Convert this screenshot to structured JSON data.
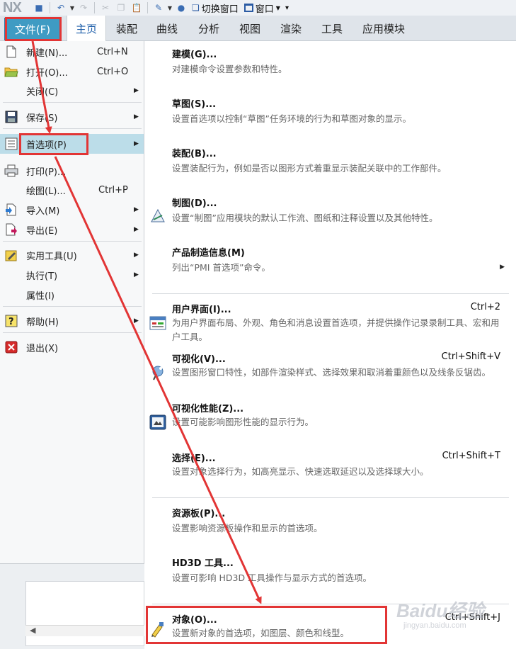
{
  "app": {
    "logo": "NX"
  },
  "quick_toolbar": {
    "switch_window_label": "切换窗口",
    "window_label": "窗口"
  },
  "ribbon": {
    "tabs": [
      {
        "label": "文件(F)"
      },
      {
        "label": "主页"
      },
      {
        "label": "装配"
      },
      {
        "label": "曲线"
      },
      {
        "label": "分析"
      },
      {
        "label": "视图"
      },
      {
        "label": "渲染"
      },
      {
        "label": "工具"
      },
      {
        "label": "应用模块"
      }
    ],
    "active_tab": "主页"
  },
  "file_menu": {
    "items": [
      {
        "label": "新建(N)...",
        "shortcut": "Ctrl+N",
        "icon": "new-file-icon"
      },
      {
        "label": "打开(O)...",
        "shortcut": "Ctrl+O",
        "icon": "open-folder-icon"
      },
      {
        "label": "关闭(C)",
        "shortcut": "",
        "icon": ""
      },
      {
        "label": "保存(S)",
        "shortcut": "",
        "icon": "save-icon"
      },
      {
        "label": "首选项(P)",
        "shortcut": "",
        "icon": "preferences-icon"
      },
      {
        "label": "打印(P)...",
        "shortcut": "",
        "icon": "printer-icon"
      },
      {
        "label": "绘图(L)...",
        "shortcut": "Ctrl+P",
        "icon": ""
      },
      {
        "label": "导入(M)",
        "shortcut": "",
        "icon": "import-icon"
      },
      {
        "label": "导出(E)",
        "shortcut": "",
        "icon": "export-icon"
      },
      {
        "label": "实用工具(U)",
        "shortcut": "",
        "icon": "utilities-icon"
      },
      {
        "label": "执行(T)",
        "shortcut": "",
        "icon": ""
      },
      {
        "label": "属性(I)",
        "shortcut": "",
        "icon": ""
      },
      {
        "label": "帮助(H)",
        "shortcut": "",
        "icon": "help-icon"
      },
      {
        "label": "退出(X)",
        "shortcut": "",
        "icon": "exit-icon"
      }
    ],
    "selected": "首选项(P)"
  },
  "preferences_panel": {
    "items": [
      {
        "title": "建模(G)...",
        "desc": "对建模命令设置参数和特性。",
        "shortcut": ""
      },
      {
        "title": "草图(S)...",
        "desc": "设置首选项以控制“草图”任务环境的行为和草图对象的显示。",
        "shortcut": ""
      },
      {
        "title": "装配(B)...",
        "desc": "设置装配行为，例如是否以图形方式着重显示装配关联中的工作部件。",
        "shortcut": ""
      },
      {
        "title": "制图(D)...",
        "desc": "设置“制图”应用模块的默认工作流、图纸和注释设置以及其他特性。",
        "shortcut": ""
      },
      {
        "title": "产品制造信息(M)",
        "desc": "列出“PMI 首选项”命令。",
        "shortcut": ""
      },
      {
        "title": "用户界面(I)...",
        "desc": "为用户界面布局、外观、角色和消息设置首选项，并提供操作记录录制工具、宏和用户工具。",
        "shortcut": "Ctrl+2"
      },
      {
        "title": "可视化(V)...",
        "desc": "设置图形窗口特性，如部件渲染样式、选择效果和取消着重颜色以及线条反锯齿。",
        "shortcut": "Ctrl+Shift+V"
      },
      {
        "title": "可视化性能(Z)...",
        "desc": "设置可能影响图形性能的显示行为。",
        "shortcut": ""
      },
      {
        "title": "选择(E)...",
        "desc": "设置对象选择行为，如高亮显示、快速选取延迟以及选择球大小。",
        "shortcut": "Ctrl+Shift+T"
      },
      {
        "title": "资源板(P)...",
        "desc": "设置影响资源板操作和显示的首选项。",
        "shortcut": ""
      },
      {
        "title": "HD3D 工具...",
        "desc": "设置可影响 HD3D 工具操作与显示方式的首选项。",
        "shortcut": ""
      },
      {
        "title": "对象(O)...",
        "desc": "设置新对象的首选项，如图层、颜色和线型。",
        "shortcut": "Ctrl+Shift+J"
      }
    ]
  },
  "watermark": {
    "brand": "Baidu经验",
    "url": "jingyan.baidu.com"
  },
  "colors": {
    "file_tab_bg": "#3f9bc3",
    "selected_item_bg": "#bcdde9",
    "annotation_red": "#e23535"
  }
}
